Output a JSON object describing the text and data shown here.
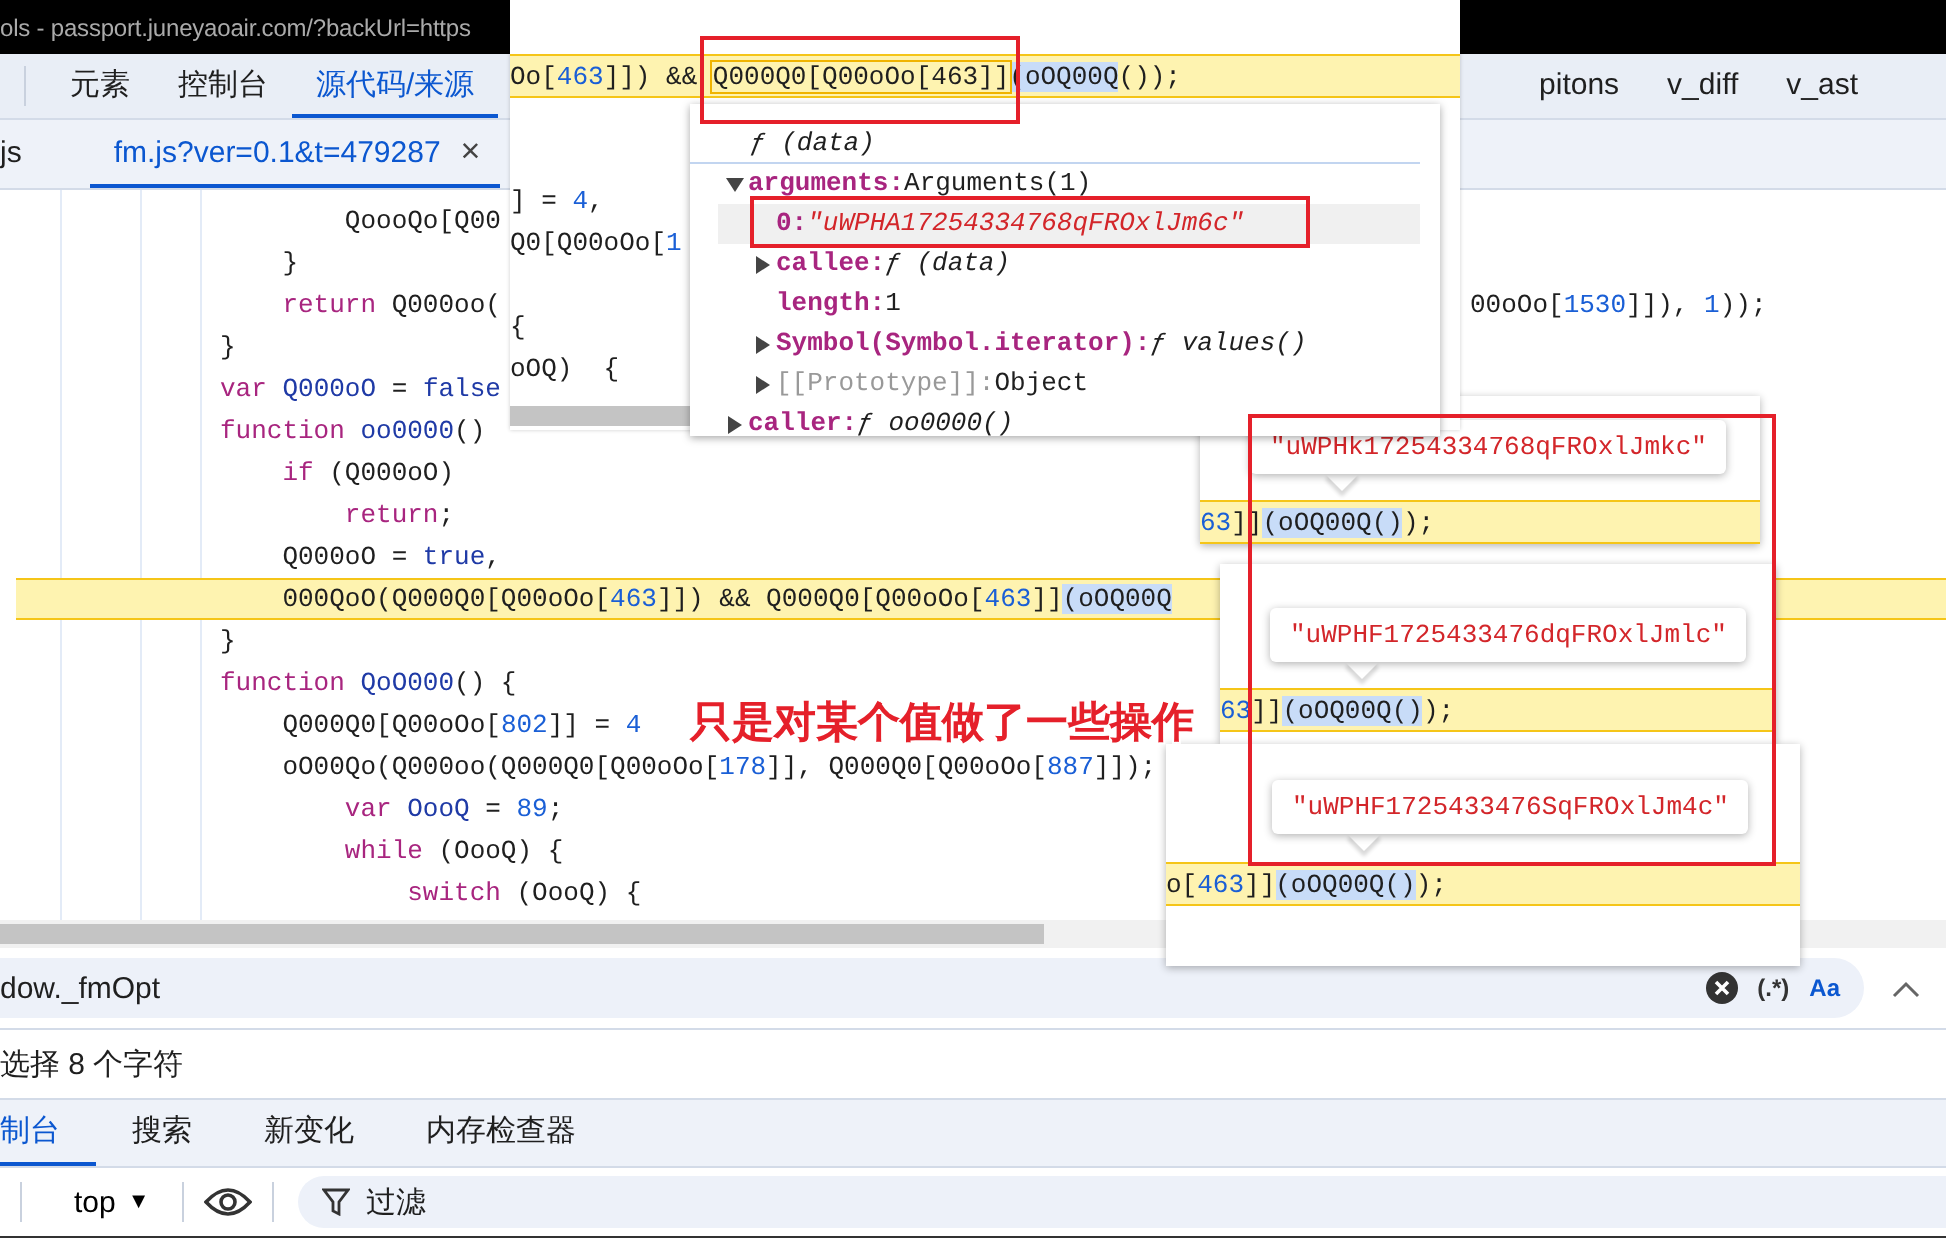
{
  "window": {
    "title": "ols - passport.juneyaoair.com/?backUrl=https"
  },
  "panel_tabs": [
    {
      "label": "元素",
      "selected": false
    },
    {
      "label": "控制台",
      "selected": false
    },
    {
      "label": "源代码/来源",
      "selected": true
    }
  ],
  "more_panel_tabs": [
    {
      "label": "pitons",
      "selected": false
    },
    {
      "label": "v_diff",
      "selected": false
    },
    {
      "label": "v_ast",
      "selected": false
    }
  ],
  "file_tabs": [
    {
      "label": "js",
      "selected": false
    },
    {
      "label": "fm.js?ver=0.1&t=479287",
      "selected": true,
      "close": "×"
    }
  ],
  "code_lines": [
    {
      "highlighted": false,
      "tokens": [
        {
          "kind": "plain",
          "text": "        QoooQo[Q00"
        }
      ]
    },
    {
      "highlighted": false,
      "tokens": [
        {
          "kind": "plain",
          "text": "    }"
        }
      ]
    },
    {
      "highlighted": false,
      "tokens": [
        {
          "kind": "kw",
          "text": "    return"
        },
        {
          "kind": "plain",
          "text": " Q000oo("
        }
      ],
      "tail": [
        {
          "kind": "plain",
          "text": "00oOo["
        },
        {
          "kind": "num",
          "text": "1530"
        },
        {
          "kind": "plain",
          "text": "]]), "
        },
        {
          "kind": "num",
          "text": "1"
        },
        {
          "kind": "plain",
          "text": "));"
        }
      ]
    },
    {
      "highlighted": false,
      "tokens": [
        {
          "kind": "plain",
          "text": "}"
        }
      ]
    },
    {
      "highlighted": false,
      "tokens": [
        {
          "kind": "kw",
          "text": "var "
        },
        {
          "kind": "def",
          "text": "Q000oO"
        },
        {
          "kind": "plain",
          "text": " = "
        },
        {
          "kind": "def",
          "text": "false"
        }
      ]
    },
    {
      "highlighted": false,
      "tokens": [
        {
          "kind": "kw",
          "text": "function "
        },
        {
          "kind": "def",
          "text": "oo0000"
        },
        {
          "kind": "plain",
          "text": "()"
        }
      ]
    },
    {
      "highlighted": false,
      "tokens": [
        {
          "kind": "kw",
          "text": "    if"
        },
        {
          "kind": "plain",
          "text": " (Q000oO)"
        }
      ]
    },
    {
      "highlighted": false,
      "tokens": [
        {
          "kind": "kw",
          "text": "        return"
        },
        {
          "kind": "plain",
          "text": ";"
        }
      ]
    },
    {
      "highlighted": false,
      "tokens": [
        {
          "kind": "plain",
          "text": "    Q000oO = "
        },
        {
          "kind": "def",
          "text": "true"
        },
        {
          "kind": "plain",
          "text": ","
        }
      ]
    },
    {
      "highlighted": true,
      "tokens": [
        {
          "kind": "plain",
          "text": "    000QoO(Q000Q0[Q00oOo["
        },
        {
          "kind": "num",
          "text": "463"
        },
        {
          "kind": "plain",
          "text": "]]) && Q000Q0[Q00oOo["
        },
        {
          "kind": "num",
          "text": "463"
        },
        {
          "kind": "plain",
          "text": "]]"
        },
        {
          "kind": "sel",
          "text": "(oOQ00Q"
        }
      ]
    },
    {
      "highlighted": false,
      "tokens": [
        {
          "kind": "plain",
          "text": "}"
        }
      ]
    },
    {
      "highlighted": false,
      "tokens": [
        {
          "kind": "kw",
          "text": "function "
        },
        {
          "kind": "def",
          "text": "QoO000"
        },
        {
          "kind": "plain",
          "text": "() {"
        }
      ]
    },
    {
      "highlighted": false,
      "tokens": [
        {
          "kind": "plain",
          "text": "    Q000Q0[Q00oOo["
        },
        {
          "kind": "num",
          "text": "802"
        },
        {
          "kind": "plain",
          "text": "]] = "
        },
        {
          "kind": "num",
          "text": "4"
        }
      ]
    },
    {
      "highlighted": false,
      "tokens": [
        {
          "kind": "plain",
          "text": "    oO00Qo(Q000oo(Q000Q0[Q00oOo["
        },
        {
          "kind": "num",
          "text": "178"
        },
        {
          "kind": "plain",
          "text": "]], Q000Q0[Q00oOo["
        },
        {
          "kind": "num",
          "text": "887"
        },
        {
          "kind": "plain",
          "text": "]]);"
        }
      ]
    },
    {
      "highlighted": false,
      "tokens": [
        {
          "kind": "kw",
          "text": "        var "
        },
        {
          "kind": "def",
          "text": "OooQ"
        },
        {
          "kind": "plain",
          "text": " = "
        },
        {
          "kind": "num",
          "text": "89"
        },
        {
          "kind": "plain",
          "text": ";"
        }
      ]
    },
    {
      "highlighted": false,
      "tokens": [
        {
          "kind": "kw",
          "text": "        while"
        },
        {
          "kind": "plain",
          "text": " (OooQ) {"
        }
      ]
    },
    {
      "highlighted": false,
      "tokens": [
        {
          "kind": "kw",
          "text": "            switch"
        },
        {
          "kind": "plain",
          "text": " (OooQ) {"
        }
      ]
    }
  ],
  "annotation": "只是对某个值做了一些操作",
  "hover_window": {
    "line": [
      {
        "kind": "plain",
        "text": "Oo["
      },
      {
        "kind": "num",
        "text": "463"
      },
      {
        "kind": "plain",
        "text": "]]) && "
      },
      {
        "kind": "hit",
        "text": "Q000Q0[Q00oOo[463]]"
      },
      {
        "kind": "sel",
        "text": "(oOQ00Q"
      },
      {
        "kind": "plain",
        "text": "());"
      }
    ],
    "fragments": [
      [
        {
          "kind": "plain",
          "text": "] = "
        },
        {
          "kind": "num",
          "text": "4"
        },
        {
          "kind": "plain",
          "text": ","
        }
      ],
      [
        {
          "kind": "plain",
          "text": "Q0[Q00oOo["
        },
        {
          "kind": "num",
          "text": "1"
        }
      ],
      [
        {
          "kind": "plain",
          "text": "{"
        }
      ],
      [
        {
          "kind": "plain",
          "text": "oOQ)  {"
        }
      ]
    ],
    "object_preview": {
      "header": "ƒ (data)",
      "properties": [
        {
          "name": "arguments:",
          "value": "Arguments(1)",
          "kind": "object",
          "expanded": true,
          "dimmed": false,
          "selected": false,
          "children": [
            {
              "name": "0:",
              "value": "\"uWPHA17254334768qFROxlJm6c\"",
              "kind": "string",
              "dimmed": false,
              "selected": true
            },
            {
              "name": "callee:",
              "value": "ƒ (data)",
              "kind": "function",
              "expanded": false,
              "dimmed": false,
              "selected": false
            },
            {
              "name": "length:",
              "value": "1",
              "kind": "object",
              "dimmed": false,
              "selected": false
            },
            {
              "name": "Symbol(Symbol.iterator):",
              "value": "ƒ values()",
              "kind": "function",
              "expanded": false,
              "dimmed": false,
              "selected": false
            },
            {
              "name": "[[Prototype]]:",
              "value": "Object",
              "kind": "object",
              "expanded": false,
              "dimmed": true,
              "selected": false
            }
          ]
        },
        {
          "name": "caller:",
          "value": "ƒ oo0000()",
          "kind": "function",
          "expanded": false,
          "dimmed": false,
          "selected": false
        }
      ]
    }
  },
  "value_popups": [
    {
      "value": "\"uWPHk17254334768qFROxlJmkc\"",
      "code": [
        {
          "kind": "num",
          "text": "63"
        },
        {
          "kind": "plain",
          "text": "]]"
        },
        {
          "kind": "sel",
          "text": "(oOQ00Q()"
        },
        {
          "kind": "plain",
          "text": ");"
        }
      ]
    },
    {
      "value": "\"uWPHF1725433476dqFROxlJmlc\"",
      "code": [
        {
          "kind": "num",
          "text": "63"
        },
        {
          "kind": "plain",
          "text": "]]"
        },
        {
          "kind": "sel",
          "text": "(oOQ00Q()"
        },
        {
          "kind": "plain",
          "text": ");"
        }
      ]
    },
    {
      "value": "\"uWPHF1725433476SqFROxlJm4c\"",
      "code": [
        {
          "kind": "plain",
          "text": "o["
        },
        {
          "kind": "num",
          "text": "463"
        },
        {
          "kind": "plain",
          "text": "]]"
        },
        {
          "kind": "sel",
          "text": "(oOQ00Q()"
        },
        {
          "kind": "plain",
          "text": ");"
        }
      ]
    }
  ],
  "search": {
    "value": "dow._fmOpt",
    "regex": "(.*)",
    "match_case": "Aa"
  },
  "selection_status": "选择 8 个字符",
  "drawer_tabs": [
    {
      "label": "制台",
      "selected": true
    },
    {
      "label": "搜索",
      "selected": false
    },
    {
      "label": "新变化",
      "selected": false
    },
    {
      "label": "内存检查器",
      "selected": false
    }
  ],
  "console_toolbar": {
    "context": "top",
    "context_arrow": "▼",
    "filter_placeholder": "过滤"
  }
}
